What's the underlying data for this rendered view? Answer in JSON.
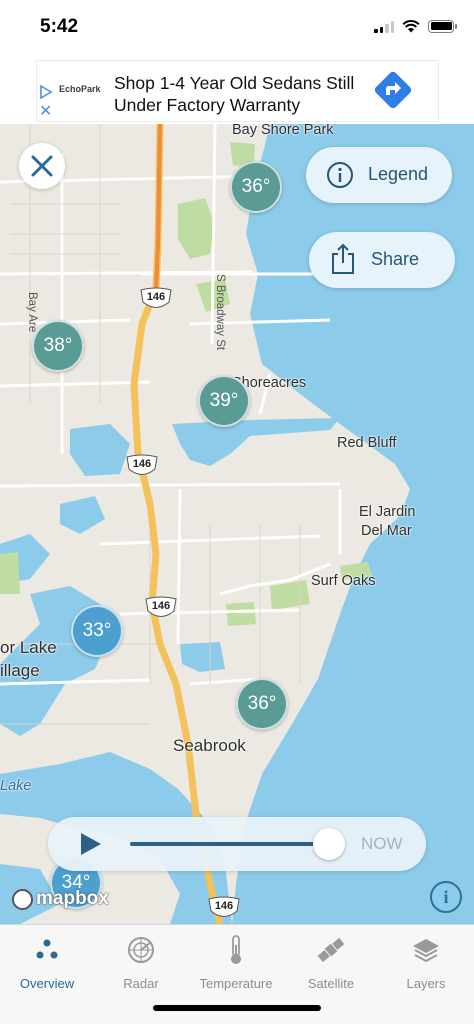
{
  "status_bar": {
    "time": "5:42"
  },
  "ad": {
    "brand": "EchoPark",
    "text": "Shop 1-4 Year Old Sedans Still Under Factory Warranty",
    "close_symbol": "✕"
  },
  "map": {
    "place_labels": {
      "bay_shore_park": "Bay Shore Park",
      "shoreacres": "Shoreacres",
      "red_bluff": "Red Bluff",
      "el_jardin_1": "El Jardin",
      "el_jardin_2": "Del Mar",
      "surf_oaks": "Surf Oaks",
      "taylor_lake_1": "or Lake",
      "taylor_lake_2": "illage",
      "seabrook": "Seabrook",
      "lake": "Lake"
    },
    "road_labels": {
      "bay_area": "Bay Are",
      "s_broadway": "S Broadway St"
    },
    "highway_shields": [
      "146",
      "146",
      "146",
      "146"
    ],
    "clusters": [
      "36°",
      "38°",
      "39°",
      "33°",
      "36°",
      "34°"
    ]
  },
  "buttons": {
    "legend": "Legend",
    "share": "Share"
  },
  "player": {
    "now_label": "NOW",
    "position_fraction": 0.9
  },
  "attribution": {
    "mapbox": "mapbox"
  },
  "tabs": [
    {
      "label": "Overview",
      "icon": "overview-dots-icon",
      "active": true
    },
    {
      "label": "Radar",
      "icon": "radar-icon",
      "active": false
    },
    {
      "label": "Temperature",
      "icon": "thermometer-icon",
      "active": false
    },
    {
      "label": "Satellite",
      "icon": "satellite-icon",
      "active": false
    },
    {
      "label": "Layers",
      "icon": "layers-icon",
      "active": false
    }
  ],
  "colors": {
    "water": "#8ccbe9",
    "land": "#ece9e2",
    "park": "#bfdca2",
    "highway": "#f3c25a",
    "accent": "#2b6a96",
    "cluster_teal": "#5b9b96",
    "cluster_blue": "#4c9fcf"
  }
}
